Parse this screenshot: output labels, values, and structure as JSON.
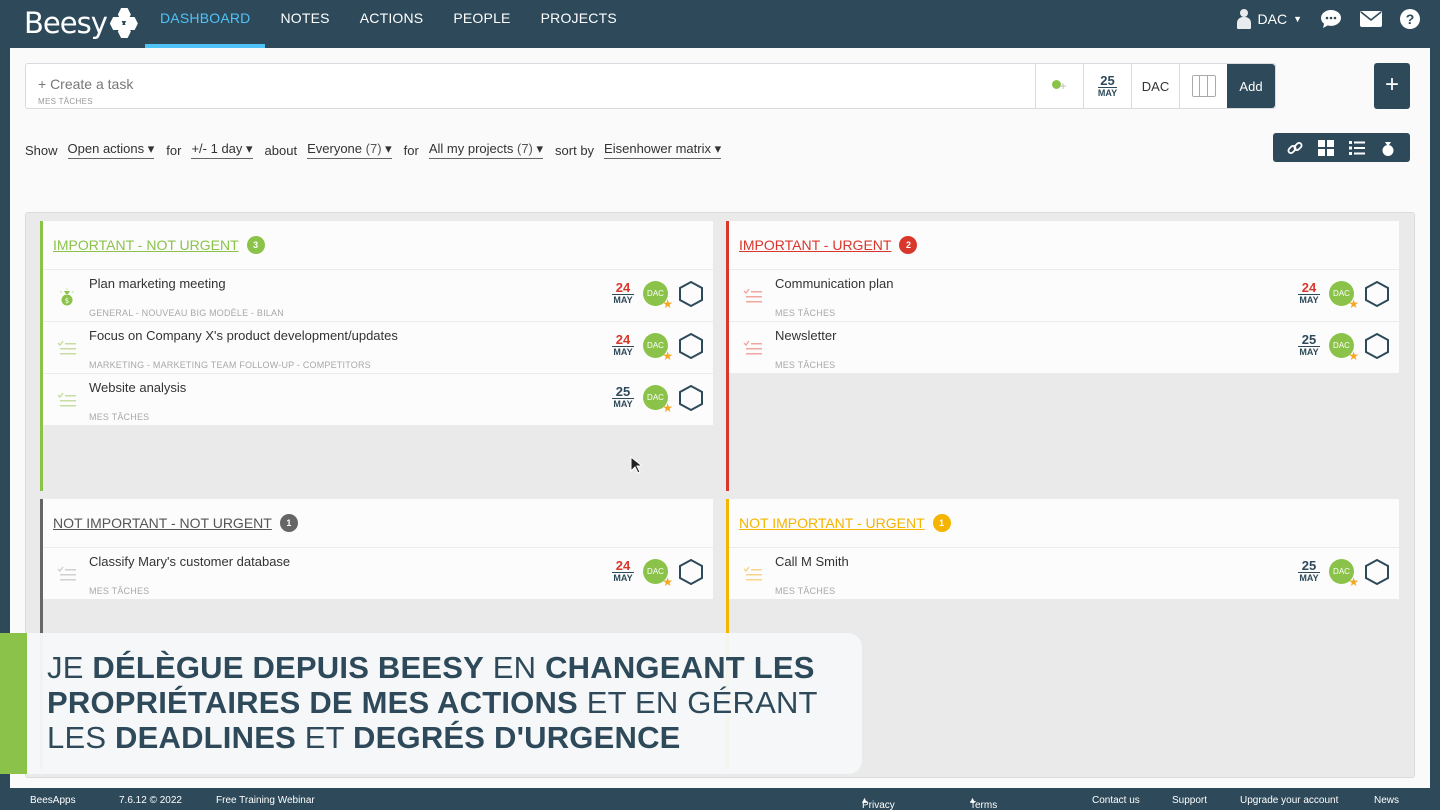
{
  "app": {
    "logo": "Beesy"
  },
  "nav": [
    {
      "label": "DASHBOARD",
      "active": true
    },
    {
      "label": "NOTES",
      "active": false
    },
    {
      "label": "ACTIONS",
      "active": false
    },
    {
      "label": "PEOPLE",
      "active": false
    },
    {
      "label": "PROJECTS",
      "active": false
    }
  ],
  "user": {
    "name": "DAC"
  },
  "taskbar": {
    "placeholder": "+ Create a task",
    "sub": "MES TÂCHES",
    "date_day": "25",
    "date_month": "MAY",
    "owner": "DAC",
    "add_label": "Add",
    "plus_label": "+"
  },
  "filters": {
    "show": "Show",
    "status": "Open actions",
    "for1": "for",
    "period": "+/- 1 day",
    "about": "about",
    "people": "Everyone",
    "people_count": "(7)",
    "for2": "for",
    "projects": "All my projects",
    "projects_count": "(7)",
    "sort": "sort by",
    "sort_value": "Eisenhower matrix"
  },
  "colors": {
    "brand": "#2e4a5a",
    "active_nav": "#4fc3f7",
    "green": "#8bc34a",
    "red": "#d9372b",
    "gray": "#666666",
    "orange": "#f5b400"
  },
  "quadrants": [
    {
      "title": "IMPORTANT - NOT URGENT",
      "count": "3",
      "color": "#8bc34a",
      "tasks": [
        {
          "title": "Plan marketing meeting",
          "project": "GENERAL - NOUVEAU BIG MODÈLE - BILAN",
          "day": "24",
          "month": "MAY",
          "day_color": "#d9372b",
          "owner": "DAC",
          "icon": "money-bag-icon"
        },
        {
          "title": "Focus on Company X's product development/updates",
          "project": "MARKETING - MARKETING TEAM FOLLOW-UP - COMPETITORS",
          "day": "24",
          "month": "MAY",
          "day_color": "#d9372b",
          "owner": "DAC",
          "icon": "checklist-icon"
        },
        {
          "title": "Website analysis",
          "project": "MES TÂCHES",
          "day": "25",
          "month": "MAY",
          "day_color": "#2e4a5a",
          "owner": "DAC",
          "icon": "checklist-icon"
        }
      ]
    },
    {
      "title": "IMPORTANT - URGENT",
      "count": "2",
      "color": "#d9372b",
      "tasks": [
        {
          "title": "Communication plan",
          "project": "MES TÂCHES",
          "day": "24",
          "month": "MAY",
          "day_color": "#d9372b",
          "owner": "DAC",
          "icon": "checklist-icon"
        },
        {
          "title": "Newsletter",
          "project": "MES TÂCHES",
          "day": "25",
          "month": "MAY",
          "day_color": "#2e4a5a",
          "owner": "DAC",
          "icon": "checklist-icon"
        }
      ]
    },
    {
      "title": "NOT IMPORTANT - NOT URGENT",
      "count": "1",
      "color": "#666666",
      "tasks": [
        {
          "title": "Classify Mary's customer database",
          "project": "MES TÂCHES",
          "day": "24",
          "month": "MAY",
          "day_color": "#d9372b",
          "owner": "DAC",
          "icon": "checklist-icon"
        }
      ]
    },
    {
      "title": "NOT IMPORTANT - URGENT",
      "count": "1",
      "color": "#f5b400",
      "tasks": [
        {
          "title": "Call M Smith",
          "project": "MES TÂCHES",
          "day": "25",
          "month": "MAY",
          "day_color": "#2e4a5a",
          "owner": "DAC",
          "icon": "checklist-icon"
        }
      ]
    }
  ],
  "caption": {
    "w1": "JE ",
    "b1": "DÉLÈGUE DEPUIS BEESY",
    "w2": " EN ",
    "b2": "CHANGEANT LES PROPRIÉTAIRES DE MES ACTIONS",
    "w3": " ET EN GÉRANT LES ",
    "b3": "DEADLINES",
    "w4": " ET ",
    "b4": "DEGRÉS D'URGENCE"
  },
  "footer": {
    "brand": "BeesApps",
    "version": "7.6.12 © 2022",
    "webinar": "Free Training Webinar",
    "privacy": "Privacy policy",
    "terms": "Terms of service",
    "contact": "Contact us",
    "support": "Support",
    "upgrade": "Upgrade your account",
    "news": "News"
  }
}
